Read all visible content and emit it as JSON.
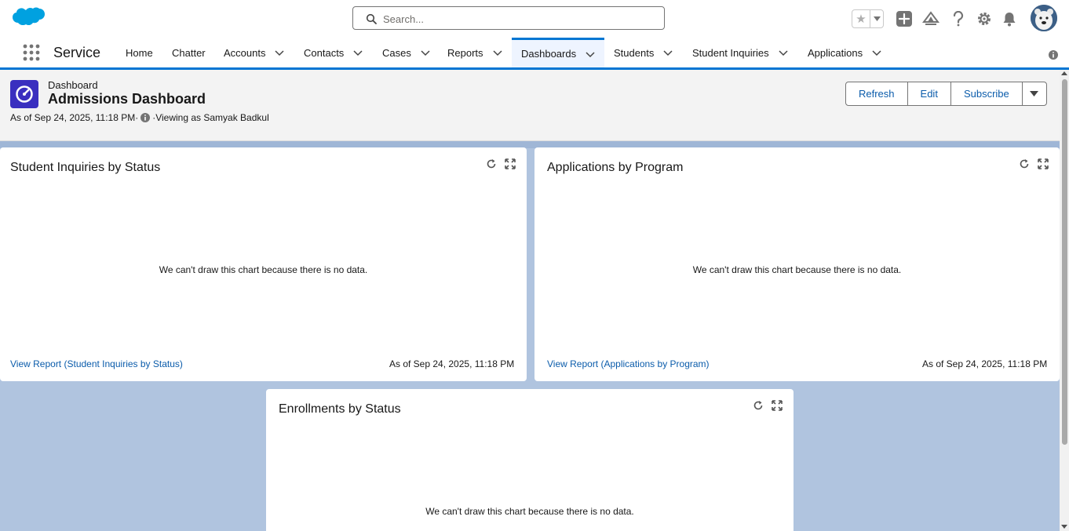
{
  "header": {
    "search_placeholder": "Search...",
    "icons": [
      "salesforce-cloud-logo",
      "search-icon",
      "favorites-star-icon",
      "chevron-down-icon",
      "global-add-icon",
      "trailhead-icon",
      "help-icon",
      "setup-gear-icon",
      "notifications-bell-icon",
      "user-avatar"
    ]
  },
  "nav": {
    "app_name": "Service",
    "items": [
      {
        "label": "Home",
        "has_menu": false
      },
      {
        "label": "Chatter",
        "has_menu": false
      },
      {
        "label": "Accounts",
        "has_menu": true
      },
      {
        "label": "Contacts",
        "has_menu": true
      },
      {
        "label": "Cases",
        "has_menu": true
      },
      {
        "label": "Reports",
        "has_menu": true
      },
      {
        "label": "Dashboards",
        "has_menu": true,
        "active": true
      },
      {
        "label": "Students",
        "has_menu": true
      },
      {
        "label": "Student Inquiries",
        "has_menu": true
      },
      {
        "label": "Applications",
        "has_menu": true
      }
    ]
  },
  "dashboard": {
    "type_label": "Dashboard",
    "title": "Admissions Dashboard",
    "as_of": "As of Sep 24, 2025, 11:18 PM·",
    "viewing_as": "·Viewing as Samyak Badkul",
    "buttons": {
      "refresh": "Refresh",
      "edit": "Edit",
      "subscribe": "Subscribe"
    }
  },
  "widgets": [
    {
      "title": "Student Inquiries by Status",
      "empty_message": "We can't draw this chart because there is no data.",
      "link": "View Report (Student Inquiries by Status)",
      "as_of": "As of Sep 24, 2025, 11:18 PM"
    },
    {
      "title": "Applications by Program",
      "empty_message": "We can't draw this chart because there is no data.",
      "link": "View Report (Applications by Program)",
      "as_of": "As of Sep 24, 2025, 11:18 PM"
    },
    {
      "title": "Enrollments by Status",
      "empty_message": "We can't draw this chart because there is no data."
    }
  ],
  "colors": {
    "brand_blue": "#0176d3",
    "link_blue": "#0b5cab",
    "dashboard_icon": "#3a2fbf",
    "canvas_background": "#b0c4df"
  }
}
